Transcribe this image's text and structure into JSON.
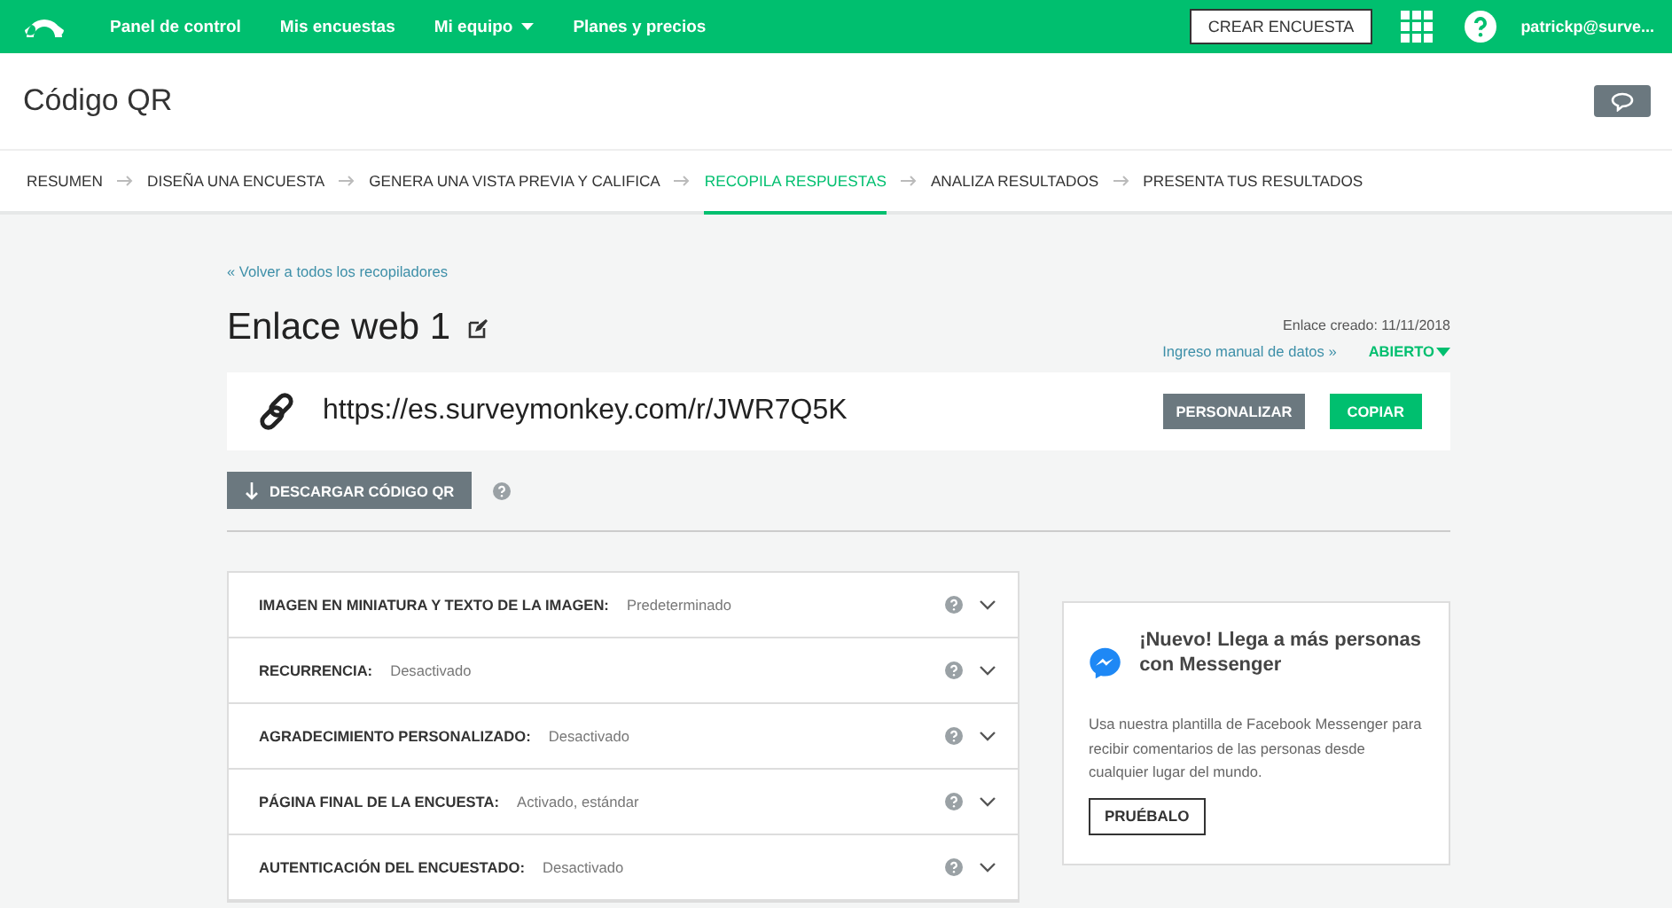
{
  "topnav": {
    "items": [
      {
        "label": "Panel de control",
        "dropdown": false
      },
      {
        "label": "Mis encuestas",
        "dropdown": false
      },
      {
        "label": "Mi equipo",
        "dropdown": true
      },
      {
        "label": "Planes y precios",
        "dropdown": false
      }
    ],
    "create_button": "CREAR ENCUESTA",
    "user": "patrickp@surve..."
  },
  "page_title": "Código QR",
  "steps": [
    {
      "label": "RESUMEN",
      "selected": false
    },
    {
      "label": "DISEÑA UNA ENCUESTA",
      "selected": false
    },
    {
      "label": "GENERA UNA VISTA PREVIA Y CALIFICA",
      "selected": false
    },
    {
      "label": "RECOPILA RESPUESTAS",
      "selected": true
    },
    {
      "label": "ANALIZA RESULTADOS",
      "selected": false
    },
    {
      "label": "PRESENTA TUS RESULTADOS",
      "selected": false
    }
  ],
  "back_link": "« Volver a todos los recopiladores",
  "collector": {
    "name": "Enlace web 1",
    "created": "Enlace creado: 11/11/2018",
    "manual_entry": "Ingreso manual de datos »",
    "status": "ABIERTO",
    "url": "https://es.surveymonkey.com/r/JWR7Q5K",
    "customize_button": "PERSONALIZAR",
    "copy_button": "COPIAR",
    "download_button": "DESCARGAR CÓDIGO QR"
  },
  "settings": [
    {
      "label": "IMAGEN EN MINIATURA Y TEXTO DE LA IMAGEN:",
      "value": "Predeterminado"
    },
    {
      "label": "RECURRENCIA:",
      "value": "Desactivado"
    },
    {
      "label": "AGRADECIMIENTO PERSONALIZADO:",
      "value": "Desactivado"
    },
    {
      "label": "PÁGINA FINAL DE LA ENCUESTA:",
      "value": "Activado, estándar"
    },
    {
      "label": "AUTENTICACIÓN DEL ENCUESTADO:",
      "value": "Desactivado"
    }
  ],
  "promo": {
    "title": "¡Nuevo! Llega a más personas con Messenger",
    "text": "Usa nuestra plantilla de Facebook Messenger para recibir comentarios de las personas desde cualquier lugar del mundo.",
    "button": "PRUÉBALO"
  }
}
